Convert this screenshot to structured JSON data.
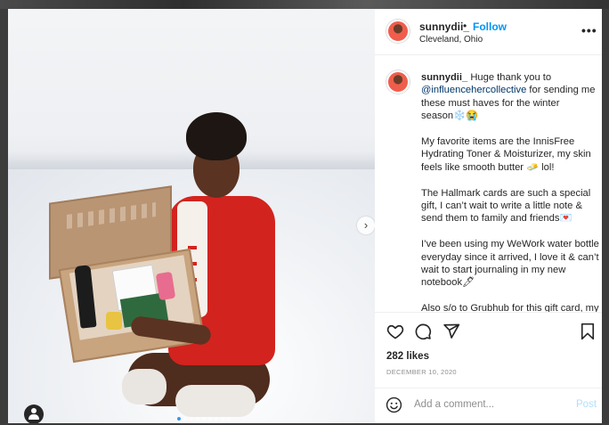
{
  "post": {
    "username": "sunnydii_",
    "separator": "•",
    "follow_label": "Follow",
    "location": "Cleveland, Ohio",
    "more_label": "•••"
  },
  "caption": {
    "username": "sunnydii_",
    "p1_pre": " Huge thank you to ",
    "mention": "@influencehercollective",
    "p1_post": " for sending me these must haves for the winter season❄️😭",
    "p2": "My favorite items are the InnisFree Hydrating Toner & Moisturizer, my skin feels like smooth butter 🧈 lol!",
    "p3": "The Hallmark cards are such a special gift, I can’t wait to write a little note & send them to family and friends💌",
    "p4": "I’ve been using my WeWork water bottle everyday since it arrived, I love it & can’t wait to start journaling in my new notebook🖊",
    "p5": "Also s/o to Grubhub for this gift card, my morning coffee and dinner delight to thank"
  },
  "stats": {
    "likes": "282 likes",
    "date": "DECEMBER 10, 2020"
  },
  "comment": {
    "placeholder": "Add a comment...",
    "post_label": "Post"
  },
  "carousel": {
    "next_label": "›",
    "slide_count": 9,
    "active_index": 0
  },
  "colors": {
    "follow": "#0095f6",
    "mention": "#00376b",
    "post_disabled": "#b2dffc",
    "muted": "#8e8e8e"
  }
}
